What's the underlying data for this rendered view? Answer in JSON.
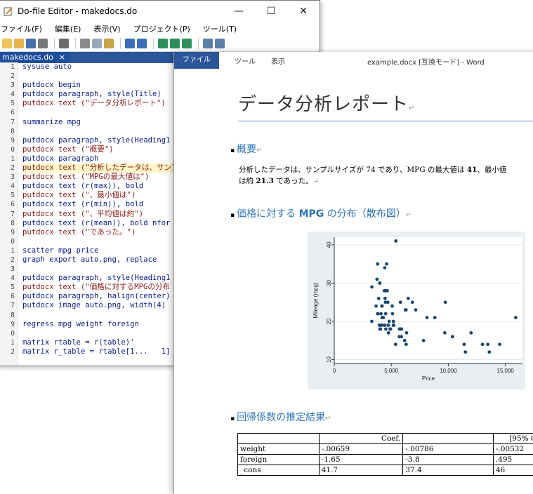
{
  "dofile": {
    "title": "Do-file Editor - makedocs.do",
    "menu": [
      "ファイル(F)",
      "編集(E)",
      "表示(V)",
      "プロジェクト(P)",
      "ツール(T)"
    ],
    "tab_label": "makedocs.do",
    "tab_close": "×",
    "line_numbers": [
      "1",
      "2",
      "3",
      "4",
      "5",
      "6",
      "7",
      "8",
      "9",
      "0",
      "1",
      "2",
      "3",
      "4",
      "5",
      "6",
      "7",
      "8",
      "9",
      "0",
      "1",
      "2",
      "3",
      "4",
      "5",
      "6",
      "7",
      "8",
      "9",
      "0",
      "1",
      "2"
    ],
    "lines": [
      "sysuse auto",
      "",
      "putdocx begin",
      "putdocx paragraph, style(Title)",
      "putdocx text (\"データ分析レポート\")",
      "",
      "summarize mpg",
      "",
      "putdocx paragraph, style(Heading1",
      "putdocx text (\"概要\")",
      "putdocx paragraph",
      "putdocx text (\"分析したデータは、サンプ",
      "putdocx text (\"MPGの最大値は\")",
      "putdocx text (r(max)), bold",
      "putdocx text (\"、最小値は\")",
      "putdocx text (r(min)), bold",
      "putdocx text (\"、平均値は約\")",
      "putdocx text (r(mean)), bold nfor",
      "putdocx text (\"であった。\")",
      "",
      "scatter mpg price",
      "graph export auto.png, replace",
      "",
      "putdocx paragraph, style(Heading1",
      "putdocx text (\"価格に対するMPGの分布",
      "putdocx paragraph, halign(center)",
      "putdocx image auto.png, width(4)",
      "",
      "regress mpg weight foreign",
      "",
      "matrix rtable = r(table)'",
      "matrix r_table = rtable[1...   1]"
    ]
  },
  "word": {
    "file_tab": "ファイル",
    "tabs": [
      "ツール",
      "表示"
    ],
    "title": "example.docx [互換モード] - Word",
    "doc_title": "データ分析レポート",
    "para_mark": "↵",
    "h_summary": "概要",
    "summary_line1_a": "分析したデータは、サンプルサイズが 74 であり、MPG の最大値は ",
    "summary_max": "41",
    "summary_line1_b": "、最小値",
    "summary_line2_a": "は約 ",
    "summary_mean": "21.3",
    "summary_line2_b": " であった。",
    "h_scatter_a": "価格に対する ",
    "h_scatter_b": "MPG",
    "h_scatter_c": " の分布（散布図）",
    "h_regression": "回帰係数の推定結果",
    "table": {
      "header": [
        "",
        "Coef.",
        "",
        "[95% C"
      ],
      "rows": [
        [
          "weight",
          "-.00659",
          "-.00786",
          "-.00532"
        ],
        [
          "foreign",
          "-1.65",
          "-3.8",
          ".495"
        ],
        [
          "_cons",
          "41.7",
          "37.4",
          "46"
        ]
      ]
    }
  },
  "chart_data": {
    "type": "scatter",
    "xlabel": "Price",
    "ylabel": "Mileage (mpg)",
    "xlim": [
      0,
      16500
    ],
    "ylim": [
      9,
      42
    ],
    "xticks": [
      0,
      5000,
      10000,
      15000
    ],
    "xtick_labels": [
      "0",
      "5,000",
      "10,000",
      "15,000"
    ],
    "yticks": [
      10,
      20,
      30,
      40
    ],
    "ytick_labels": [
      "10",
      "20",
      "30",
      "40"
    ],
    "background": "#e9eef2",
    "marker_color": "#1a476f",
    "x": [
      4099,
      4749,
      3799,
      4816,
      7827,
      5788,
      4453,
      5189,
      10372,
      4082,
      11385,
      14500,
      15906,
      3299,
      5705,
      4504,
      5104,
      3667,
      3955,
      3984,
      4010,
      5886,
      6342,
      4389,
      4187,
      11497,
      13594,
      13466,
      3829,
      5379,
      6165,
      4516,
      6303,
      3291,
      8814,
      5172,
      4733,
      4890,
      4181,
      4195,
      10371,
      4647,
      4425,
      4482,
      6486,
      4060,
      5798,
      4934,
      5222,
      4723,
      4424,
      4172,
      9690,
      6295,
      9735,
      6229,
      4589,
      5079,
      8129,
      4296,
      5799,
      4499,
      3995,
      12990,
      3895,
      3798,
      5899,
      3748,
      5719,
      7140,
      5397,
      4697,
      6850,
      11995
    ],
    "y": [
      22,
      17,
      22,
      20,
      15,
      18,
      26,
      20,
      16,
      19,
      14,
      14,
      21,
      29,
      16,
      22,
      22,
      24,
      19,
      30,
      18,
      16,
      17,
      28,
      21,
      12,
      12,
      14,
      22,
      14,
      15,
      18,
      14,
      20,
      21,
      19,
      19,
      18,
      19,
      24,
      16,
      28,
      34,
      25,
      26,
      18,
      18,
      18,
      19,
      19,
      19,
      24,
      17,
      23,
      25,
      23,
      35,
      24,
      21,
      21,
      25,
      28,
      30,
      14,
      26,
      35,
      18,
      31,
      18,
      23,
      41,
      25,
      25,
      17
    ]
  }
}
